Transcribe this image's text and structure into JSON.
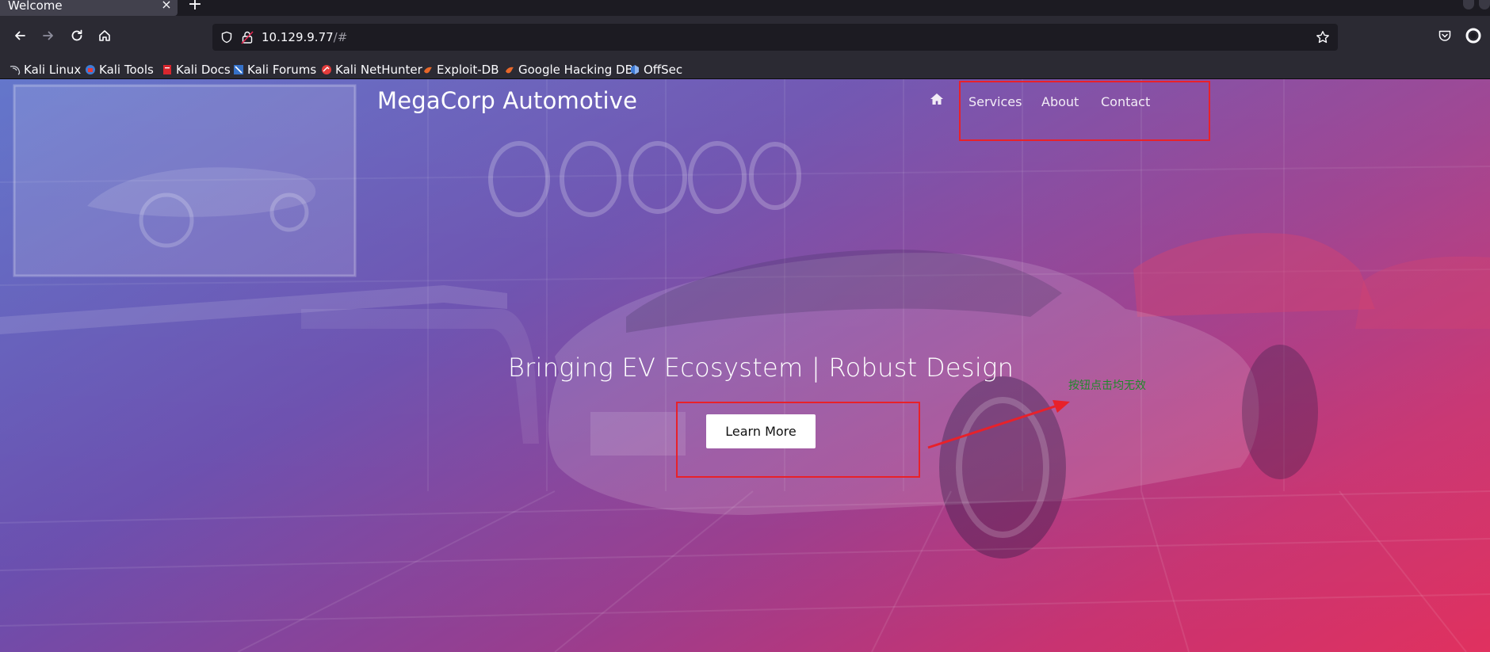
{
  "browser": {
    "tab_title": "Welcome",
    "tab_close": "×",
    "new_tab": "+",
    "url_host": "10.129.9.77",
    "url_path": "/#",
    "bookmarks": [
      {
        "label": "Kali Linux",
        "icon": "kali-dragon-icon"
      },
      {
        "label": "Kali Tools",
        "icon": "kali-tools-icon"
      },
      {
        "label": "Kali Docs",
        "icon": "kali-docs-icon"
      },
      {
        "label": "Kali Forums",
        "icon": "kali-forums-icon"
      },
      {
        "label": "Kali NetHunter",
        "icon": "nethunter-icon"
      },
      {
        "label": "Exploit-DB",
        "icon": "exploit-db-icon"
      },
      {
        "label": "Google Hacking DB",
        "icon": "ghdb-icon"
      },
      {
        "label": "OffSec",
        "icon": "offsec-icon"
      }
    ]
  },
  "site": {
    "brand": "MegaCorp Automotive",
    "nav": {
      "home_icon": "home-icon",
      "links": [
        "Services",
        "About",
        "Contact"
      ]
    },
    "hero": {
      "title": "Bringing EV Ecosystem | Robust Design",
      "button_label": "Learn More"
    }
  },
  "annotation": {
    "note": "按钮点击均无效",
    "color": "#e8212a"
  },
  "colors": {
    "gradient_start": "#5a6ec8",
    "gradient_end": "#e0315f",
    "chrome_bg": "#2b2a33",
    "tab_bg": "#42414d"
  }
}
